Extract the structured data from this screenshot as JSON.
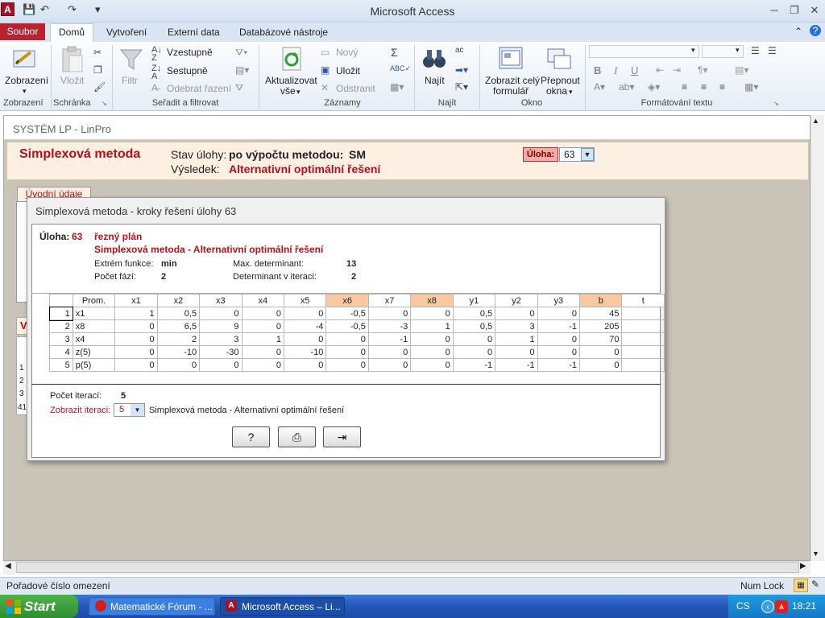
{
  "window": {
    "title": "Microsoft Access",
    "app_icon": "A"
  },
  "ribbon_tabs": [
    "Soubor",
    "Domů",
    "Vytvoření",
    "Externí data",
    "Databázové nástroje"
  ],
  "ribbon": {
    "views": {
      "label": "Zobrazení",
      "group": "Zobrazení"
    },
    "clipboard": {
      "paste": "Vložit",
      "group": "Schránka"
    },
    "sort": {
      "filter": "Filtr",
      "ascending": "Vzestupně",
      "descending": "Sestupně",
      "remove_sort": "Odebrat řazení",
      "group": "Seřadit a filtrovat"
    },
    "records": {
      "refresh": "Aktualizovat",
      "refresh2": "vše",
      "new": "Nový",
      "save": "Uložit",
      "delete": "Odstranit",
      "group": "Záznamy"
    },
    "find": {
      "find": "Najít",
      "group": "Najít"
    },
    "window": {
      "fullform1": "Zobrazit celý",
      "fullform2": "formulář",
      "switch1": "Přepnout",
      "switch2": "okna",
      "group": "Okno"
    },
    "text": {
      "bold": "B",
      "italic": "I",
      "underline": "U",
      "group": "Formátování textu"
    }
  },
  "form": {
    "caption": "SYSTÉM LP - LinPro",
    "title": "Simplexová metoda",
    "state_label": "Stav úlohy:",
    "state_value": "po výpočtu metodou:",
    "state_method": "SM",
    "result_label": "Výsledek:",
    "result_value": "Alternativní optimální řešení",
    "task_label": "Úloha:",
    "task_value": "63",
    "tab_intro": "Úvodní údaje",
    "bg_letter": "V",
    "bg_rows": [
      "1",
      "2",
      "3",
      "41"
    ]
  },
  "dialog": {
    "title": "Simplexová metoda - kroky řešení úlohy 63",
    "task_label": "Úloha:",
    "task_number": "63",
    "task_name": "řezný plán",
    "subtitle": "Simplexová metoda - Alternativní optimální řešení",
    "extreme_label": "Extrém funkce:",
    "extreme_value": "min",
    "maxdet_label": "Max. determinant:",
    "maxdet_value": "13",
    "phases_label": "Počet fází:",
    "phases_value": "2",
    "detiter_label": "Determinant v iteraci:",
    "detiter_value": "2",
    "iter_count_label": "Počet iterací:",
    "iter_count_value": "5",
    "show_iter_label": "Zobrazit iteraci:",
    "show_iter_value": "5",
    "show_iter_desc": "Simplexová metoda - Alternativní optimální řešení",
    "btn_help": "?",
    "btn_print": "⎙",
    "btn_exit": "⇥"
  },
  "table": {
    "headers": [
      "Prom.",
      "x1",
      "x2",
      "x3",
      "x4",
      "x5",
      "x6",
      "x7",
      "x8",
      "y1",
      "y2",
      "y3",
      "b",
      "t"
    ],
    "highlight": [
      "x6",
      "x8",
      "b"
    ],
    "rows": [
      {
        "idx": "1",
        "var": "x1",
        "vals": [
          "1",
          "0,5",
          "0",
          "0",
          "0",
          "-0,5",
          "0",
          "0",
          "0,5",
          "0",
          "0",
          "45",
          ""
        ]
      },
      {
        "idx": "2",
        "var": "x8",
        "vals": [
          "0",
          "6,5",
          "9",
          "0",
          "-4",
          "-0,5",
          "-3",
          "1",
          "0,5",
          "3",
          "-1",
          "205",
          ""
        ]
      },
      {
        "idx": "3",
        "var": "x4",
        "vals": [
          "0",
          "2",
          "3",
          "1",
          "0",
          "0",
          "-1",
          "0",
          "0",
          "1",
          "0",
          "70",
          ""
        ]
      },
      {
        "idx": "4",
        "var": "z(5)",
        "vals": [
          "0",
          "-10",
          "-30",
          "0",
          "-10",
          "0",
          "0",
          "0",
          "0",
          "0",
          "0",
          "0",
          ""
        ]
      },
      {
        "idx": "5",
        "var": "p(5)",
        "vals": [
          "0",
          "0",
          "0",
          "0",
          "0",
          "0",
          "0",
          "0",
          "-1",
          "-1",
          "-1",
          "0",
          ""
        ]
      }
    ]
  },
  "status": {
    "left": "Pořadové číslo omezení",
    "right": "Num Lock"
  },
  "taskbar": {
    "start": "Start",
    "tasks": [
      "Matematické Fórum - ...",
      "Microsoft Access – Li..."
    ],
    "lang": "CS",
    "time": "18:21"
  },
  "colors": {
    "accent_red": "#c0101a",
    "file_tab": "#b82331",
    "header_bg": "#fdf0e3",
    "highlight_col": "#f8c9a0"
  }
}
